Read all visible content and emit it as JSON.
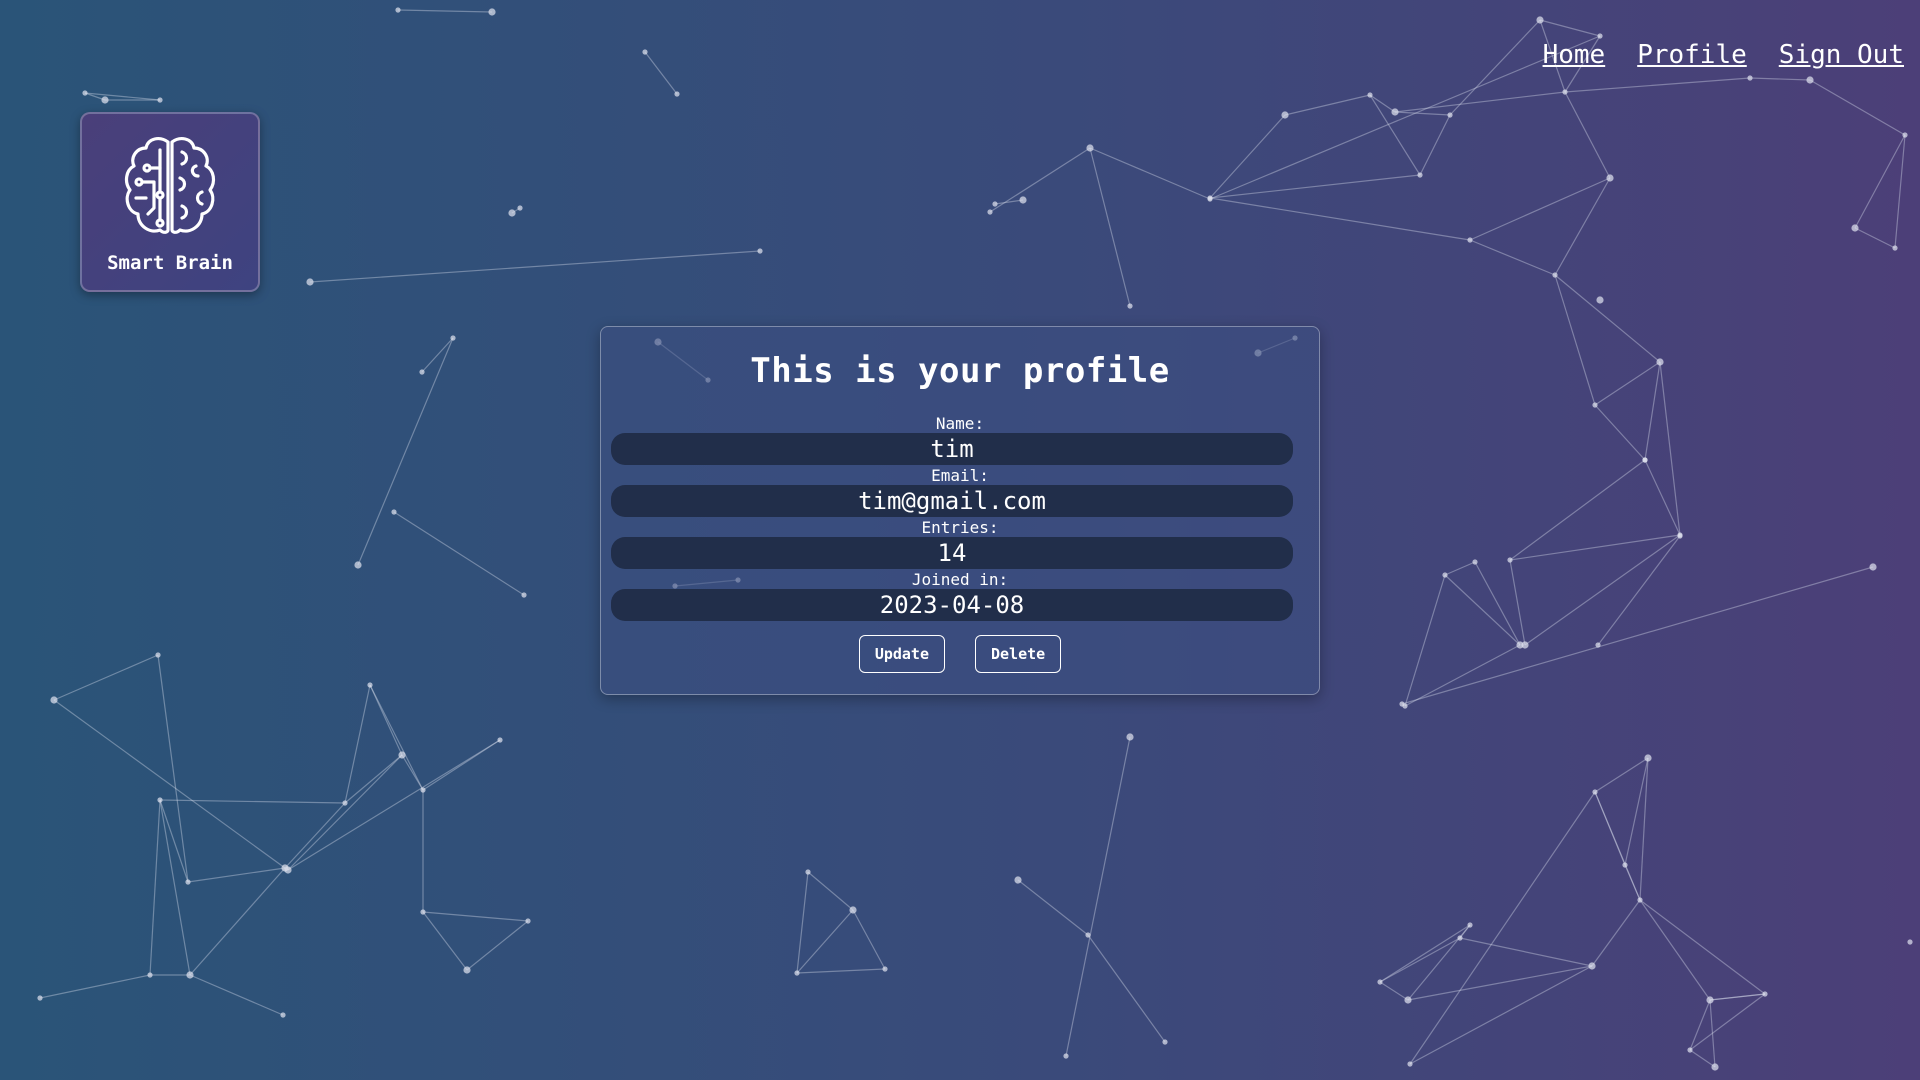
{
  "nav": {
    "home_label": "Home",
    "profile_label": "Profile",
    "signout_label": "Sign Out"
  },
  "logo": {
    "text": "Smart Brain",
    "icon": "brain-icon"
  },
  "profile": {
    "title": "This is your profile",
    "name_label": "Name:",
    "name_value": "tim",
    "email_label": "Email:",
    "email_value": "tim@gmail.com",
    "entries_label": "Entries:",
    "entries_value": "14",
    "joined_label": "Joined in:",
    "joined_value": "2023-04-08",
    "update_label": "Update",
    "delete_label": "Delete"
  },
  "colors": {
    "background_left": "#2a5478",
    "background_right": "#4c3f78",
    "field_bg": "#212e4a"
  }
}
